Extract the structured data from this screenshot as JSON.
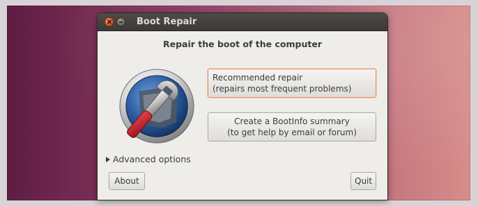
{
  "window": {
    "title": "Boot Repair"
  },
  "main": {
    "heading": "Repair the boot of the computer",
    "recommended_repair": {
      "line1": "Recommended repair",
      "line2": "(repairs most frequent problems)"
    },
    "bootinfo_summary": {
      "line1": "Create a BootInfo summary",
      "line2": "(to get help by email or forum)"
    },
    "advanced_options_label": "Advanced options"
  },
  "footer": {
    "about_label": "About",
    "quit_label": "Quit"
  },
  "icons": {
    "close": "close-icon",
    "minimize": "minimize-icon",
    "app_logo": "wrench-icon",
    "expander": "triangle-right-icon"
  },
  "colors": {
    "focus_border": "#e98b5d",
    "close_button": "#e05a2a",
    "titlebar": "#3c3a36",
    "desktop_left": "#5e1d43",
    "desktop_right": "#d78d8a",
    "wrench_handle": "#c8202b",
    "logo_ring": "#2d5fa3"
  }
}
